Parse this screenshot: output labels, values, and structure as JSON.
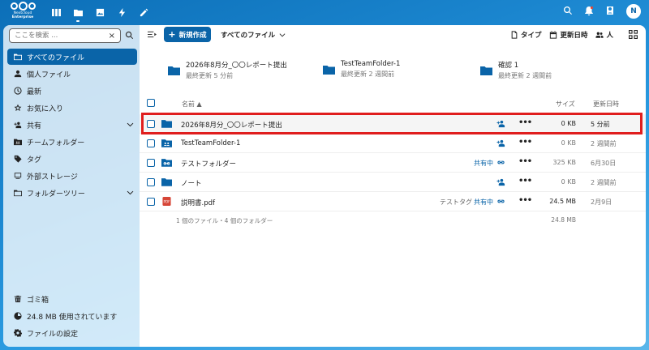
{
  "brand": {
    "line1": "Nextcloud",
    "line2": "Enterprise"
  },
  "user": {
    "avatar_initial": "N"
  },
  "search": {
    "placeholder": "ここを検索 ...",
    "clear": "×"
  },
  "sidebar": {
    "items": [
      {
        "label": "すべてのファイル",
        "icon": "folder-icon",
        "active": true
      },
      {
        "label": "個人ファイル",
        "icon": "user-icon"
      },
      {
        "label": "最新",
        "icon": "clock-icon"
      },
      {
        "label": "お気に入り",
        "icon": "star-icon"
      },
      {
        "label": "共有",
        "icon": "share-icon",
        "expandable": true
      },
      {
        "label": "チームフォルダー",
        "icon": "team-folder-icon"
      },
      {
        "label": "タグ",
        "icon": "tag-icon"
      },
      {
        "label": "外部ストレージ",
        "icon": "external-storage-icon"
      },
      {
        "label": "フォルダーツリー",
        "icon": "folder-tree-icon",
        "expandable": true
      }
    ],
    "bottom": [
      {
        "label": "ゴミ箱",
        "icon": "trash-icon"
      },
      {
        "label": "24.8 MB 使用されています",
        "icon": "storage-icon"
      },
      {
        "label": "ファイルの設定",
        "icon": "gear-icon"
      }
    ]
  },
  "toolbar": {
    "new_label": "新規作成",
    "breadcrumb": "すべてのファイル",
    "filters": {
      "type": "タイプ",
      "modified": "更新日時",
      "people": "人"
    }
  },
  "recent": [
    {
      "name": "2026年8月分_〇〇レポート提出",
      "sub": "最終更新 5 分前"
    },
    {
      "name": "TestTeamFolder-1",
      "sub": "最終更新 2 週間前"
    },
    {
      "name": "確認 1",
      "sub": "最終更新 2 週間前"
    }
  ],
  "table": {
    "headers": {
      "name": "名前",
      "size": "サイズ",
      "modified": "更新日時"
    },
    "rows": [
      {
        "name": "2026年8月分_〇〇レポート提出",
        "type": "folder",
        "tag": "",
        "shared": "",
        "size": "0 KB",
        "date": "5 分前",
        "highlight": true
      },
      {
        "name": "TestTeamFolder-1",
        "type": "team-folder",
        "tag": "",
        "shared": "",
        "size": "0 KB",
        "date": "2 週間前"
      },
      {
        "name": "テストフォルダー",
        "type": "link-folder",
        "tag": "",
        "shared": "共有中",
        "size": "325 KB",
        "date": "6月30日"
      },
      {
        "name": "ノート",
        "type": "folder",
        "tag": "",
        "shared": "",
        "size": "0 KB",
        "date": "2 週間前"
      },
      {
        "name": "説明書.pdf",
        "type": "pdf",
        "tag": "テストタグ",
        "shared": "共有中",
        "size": "24.5 MB",
        "date": "2月9日"
      }
    ],
    "summary": {
      "text": "1 個のファイル・4 個のフォルダー",
      "total": "24.8 MB"
    }
  },
  "colors": {
    "accent": "#0a64a8",
    "highlight_border": "#e01e1e",
    "pdf": "#d64537"
  }
}
